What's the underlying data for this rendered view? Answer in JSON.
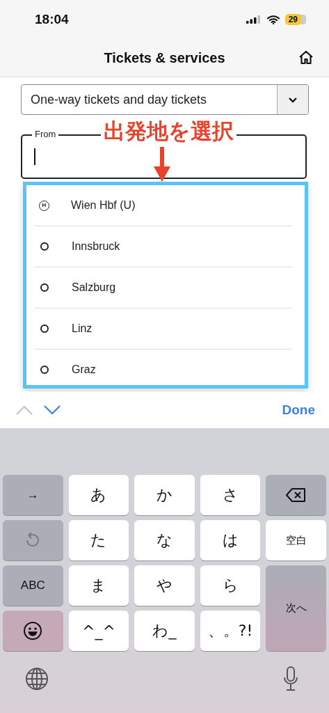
{
  "status_bar": {
    "time": "18:04",
    "battery": "29"
  },
  "header": {
    "title": "Tickets & services"
  },
  "ticket_type_select": {
    "value": "One-way tickets and day tickets"
  },
  "from_field": {
    "label": "From"
  },
  "annotation": {
    "text": "出発地を選択"
  },
  "suggestions": [
    {
      "name": "Wien Hbf (U)",
      "kind": "station",
      "badge": "H"
    },
    {
      "name": "Innsbruck",
      "kind": "city"
    },
    {
      "name": "Salzburg",
      "kind": "city"
    },
    {
      "name": "Linz",
      "kind": "city"
    },
    {
      "name": "Graz",
      "kind": "city"
    }
  ],
  "keyboard_toolbar": {
    "previous_disabled": true,
    "next_disabled": false,
    "done": "Done"
  },
  "keyboard": {
    "keys": [
      {
        "kind": "function",
        "label": "→"
      },
      {
        "kind": "char",
        "label": "あ"
      },
      {
        "kind": "char",
        "label": "か"
      },
      {
        "kind": "char",
        "label": "さ"
      },
      {
        "kind": "backspace"
      },
      {
        "kind": "undo"
      },
      {
        "kind": "char",
        "label": "た"
      },
      {
        "kind": "char",
        "label": "な"
      },
      {
        "kind": "char",
        "label": "は"
      },
      {
        "kind": "space",
        "label": "空白"
      },
      {
        "kind": "function",
        "label": "ABC"
      },
      {
        "kind": "char",
        "label": "ま"
      },
      {
        "kind": "char",
        "label": "や"
      },
      {
        "kind": "char",
        "label": "ら"
      },
      {
        "kind": "return",
        "label": "次へ"
      },
      {
        "kind": "emoji"
      },
      {
        "kind": "char",
        "label": "^_^"
      },
      {
        "kind": "char",
        "label": "わ_"
      },
      {
        "kind": "char",
        "label": "、。?!"
      }
    ]
  }
}
